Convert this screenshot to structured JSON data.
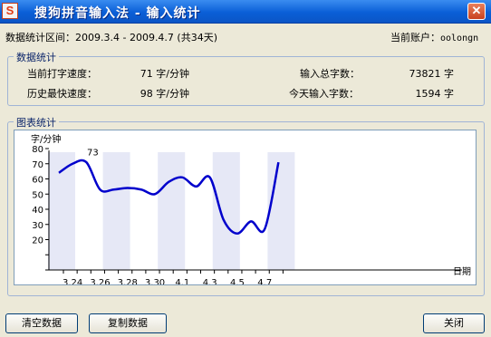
{
  "window": {
    "icon_letter": "S",
    "title": "搜狗拼音输入法 - 输入统计",
    "close_glyph": "✕"
  },
  "summary": {
    "range_text": "数据统计区间：2009.3.4 - 2009.4.7 (共34天)",
    "account_label": "当前账户：",
    "account_value": "oolongn"
  },
  "stats": {
    "group_title": "数据统计",
    "current_speed_label": "当前打字速度：",
    "current_speed_value": "71 字/分钟",
    "fastest_speed_label": "历史最快速度：",
    "fastest_speed_value": "98 字/分钟",
    "total_chars_label": "输入总字数：",
    "total_chars_value": "73821 字",
    "today_chars_label": "今天输入字数：",
    "today_chars_value": "1594 字"
  },
  "chart_group": {
    "title": "图表统计"
  },
  "chart_data": {
    "type": "line",
    "ylabel": "字/分钟",
    "xlabel": "日期",
    "y_ticks": [
      20,
      30,
      40,
      50,
      60,
      70,
      80
    ],
    "ylim": [
      0,
      85
    ],
    "x_ticks": [
      "3.24",
      "3.26",
      "3.28",
      "3.30",
      "4.1",
      "4.3",
      "4.5",
      "4.7"
    ],
    "annotation": "73",
    "line_color": "#0000cc",
    "band_color": "#e6e8f6",
    "points": [
      {
        "x": "3.23",
        "y": 64
      },
      {
        "x": "3.24",
        "y": 70
      },
      {
        "x": "3.25",
        "y": 71
      },
      {
        "x": "3.26",
        "y": 53
      },
      {
        "x": "3.27",
        "y": 53
      },
      {
        "x": "3.28",
        "y": 54
      },
      {
        "x": "3.29",
        "y": 53
      },
      {
        "x": "3.30",
        "y": 50
      },
      {
        "x": "3.31",
        "y": 58
      },
      {
        "x": "4.1",
        "y": 61
      },
      {
        "x": "4.2",
        "y": 55
      },
      {
        "x": "4.3",
        "y": 61
      },
      {
        "x": "4.4",
        "y": 33
      },
      {
        "x": "4.5",
        "y": 24
      },
      {
        "x": "4.6",
        "y": 32
      },
      {
        "x": "4.7",
        "y": 27
      },
      {
        "x": "4.8",
        "y": 71
      }
    ]
  },
  "buttons": {
    "clear_label": "清空数据",
    "copy_label": "复制数据",
    "close_label": "关闭"
  }
}
